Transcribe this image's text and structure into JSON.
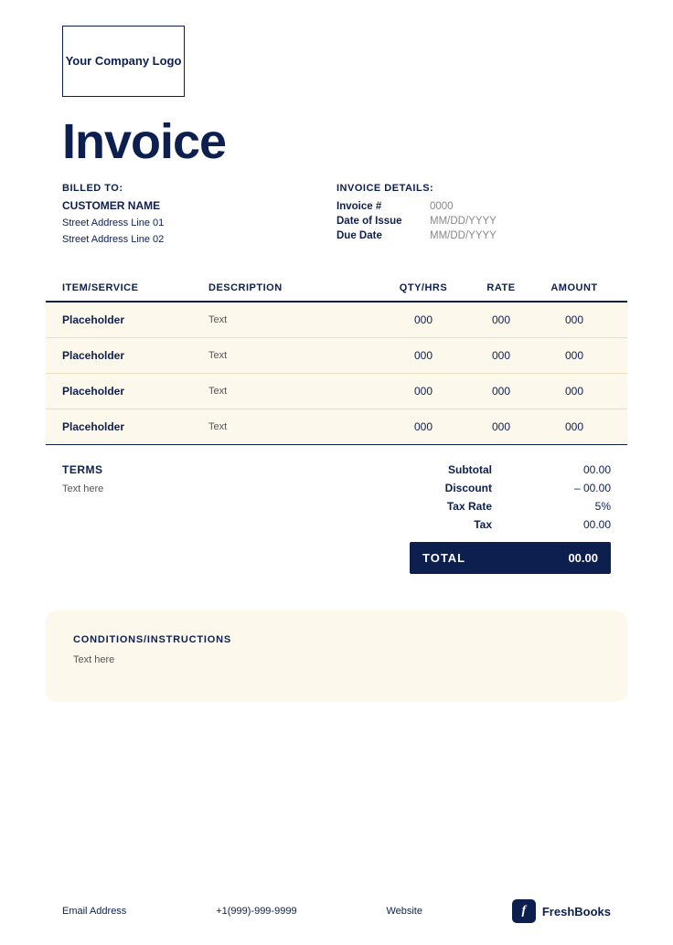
{
  "logo": {
    "text": "Your Company Logo"
  },
  "invoice": {
    "title": "Invoice"
  },
  "billed_to": {
    "label": "BILLED TO:",
    "customer_name": "CUSTOMER NAME",
    "address_line1": "Street Address Line 01",
    "address_line2": "Street Address Line 02"
  },
  "invoice_details": {
    "label": "INVOICE DETAILS:",
    "fields": [
      {
        "key": "Invoice #",
        "value": "0000"
      },
      {
        "key": "Date of Issue",
        "value": "MM/DD/YYYY"
      },
      {
        "key": "Due Date",
        "value": "MM/DD/YYYY"
      }
    ]
  },
  "table": {
    "headers": [
      "ITEM/SERVICE",
      "DESCRIPTION",
      "QTY/HRS",
      "RATE",
      "AMOUNT"
    ],
    "rows": [
      {
        "item": "Placeholder",
        "desc": "Text",
        "qty": "000",
        "rate": "000",
        "amount": "000"
      },
      {
        "item": "Placeholder",
        "desc": "Text",
        "qty": "000",
        "rate": "000",
        "amount": "000"
      },
      {
        "item": "Placeholder",
        "desc": "Text",
        "qty": "000",
        "rate": "000",
        "amount": "000"
      },
      {
        "item": "Placeholder",
        "desc": "Text",
        "qty": "000",
        "rate": "000",
        "amount": "000"
      }
    ]
  },
  "terms": {
    "label": "TERMS",
    "text": "Text here"
  },
  "totals": {
    "subtotal_label": "Subtotal",
    "subtotal_value": "00.00",
    "discount_label": "Discount",
    "discount_value": "– 00.00",
    "tax_rate_label": "Tax Rate",
    "tax_rate_value": "5%",
    "tax_label": "Tax",
    "tax_value": "00.00",
    "total_label": "TOTAL",
    "total_value": "00.00"
  },
  "conditions": {
    "label": "CONDITIONS/INSTRUCTIONS",
    "text": "Text here"
  },
  "footer": {
    "email": "Email Address",
    "phone": "+1(999)-999-9999",
    "website": "Website",
    "brand": "FreshBooks",
    "brand_icon": "f"
  }
}
